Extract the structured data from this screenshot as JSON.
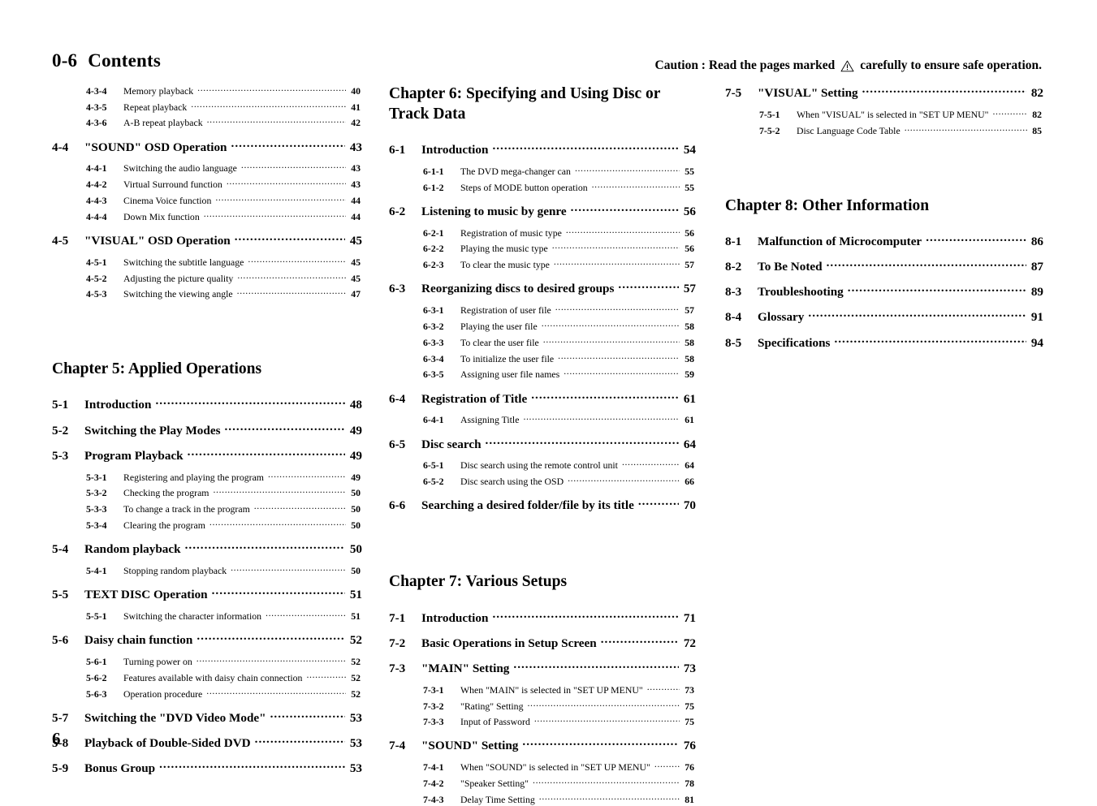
{
  "header": {
    "section_number": "0-6",
    "title": "Contents",
    "caution_prefix": "Caution : Read the pages marked",
    "caution_icon": "warning-triangle-icon",
    "caution_suffix": "carefully to ensure safe operation."
  },
  "folio": "6",
  "columns": [
    {
      "id": "column-1",
      "blocks": [
        {
          "type": "group",
          "entries": [
            {
              "level": 2,
              "num": "4-3-4",
              "title": "Memory playback",
              "page": "40"
            },
            {
              "level": 2,
              "num": "4-3-5",
              "title": "Repeat playback",
              "page": "41"
            },
            {
              "level": 2,
              "num": "4-3-6",
              "title": "A-B repeat playback",
              "page": "42"
            }
          ]
        },
        {
          "type": "group",
          "entries": [
            {
              "level": 1,
              "num": "4-4",
              "title": "\"SOUND\" OSD Operation",
              "page": "43"
            },
            {
              "level": 2,
              "num": "4-4-1",
              "title": "Switching the audio language",
              "page": "43"
            },
            {
              "level": 2,
              "num": "4-4-2",
              "title": "Virtual Surround function",
              "page": "43"
            },
            {
              "level": 2,
              "num": "4-4-3",
              "title": "Cinema Voice function",
              "page": "44"
            },
            {
              "level": 2,
              "num": "4-4-4",
              "title": "Down Mix function",
              "page": "44"
            }
          ]
        },
        {
          "type": "group",
          "entries": [
            {
              "level": 1,
              "num": "4-5",
              "title": "\"VISUAL\" OSD Operation",
              "page": "45"
            },
            {
              "level": 2,
              "num": "4-5-1",
              "title": "Switching the subtitle language",
              "page": "45"
            },
            {
              "level": 2,
              "num": "4-5-2",
              "title": "Adjusting the picture quality",
              "page": "45"
            },
            {
              "level": 2,
              "num": "4-5-3",
              "title": "Switching the viewing angle",
              "page": "47"
            }
          ]
        },
        {
          "type": "gap-xl"
        },
        {
          "type": "chapter",
          "title": "Chapter 5: Applied Operations"
        },
        {
          "type": "group",
          "entries": [
            {
              "level": 1,
              "num": "5-1",
              "title": "Introduction",
              "page": "48"
            }
          ]
        },
        {
          "type": "group",
          "entries": [
            {
              "level": 1,
              "num": "5-2",
              "title": "Switching the Play Modes",
              "page": "49"
            }
          ]
        },
        {
          "type": "group",
          "entries": [
            {
              "level": 1,
              "num": "5-3",
              "title": "Program Playback",
              "page": "49"
            },
            {
              "level": 2,
              "num": "5-3-1",
              "title": "Registering and playing the program",
              "page": "49"
            },
            {
              "level": 2,
              "num": "5-3-2",
              "title": "Checking the program",
              "page": "50"
            },
            {
              "level": 2,
              "num": "5-3-3",
              "title": "To change a track in the program",
              "page": "50"
            },
            {
              "level": 2,
              "num": "5-3-4",
              "title": "Clearing the program",
              "page": "50"
            }
          ]
        },
        {
          "type": "group",
          "entries": [
            {
              "level": 1,
              "num": "5-4",
              "title": "Random playback",
              "page": "50"
            },
            {
              "level": 2,
              "num": "5-4-1",
              "title": "Stopping random playback",
              "page": "50"
            }
          ]
        },
        {
          "type": "group",
          "entries": [
            {
              "level": 1,
              "num": "5-5",
              "title": "TEXT DISC Operation",
              "page": "51"
            },
            {
              "level": 2,
              "num": "5-5-1",
              "title": "Switching the character information",
              "page": "51"
            }
          ]
        },
        {
          "type": "group",
          "entries": [
            {
              "level": 1,
              "num": "5-6",
              "title": "Daisy chain function",
              "page": "52"
            },
            {
              "level": 2,
              "num": "5-6-1",
              "title": "Turning power on",
              "page": "52"
            },
            {
              "level": 2,
              "num": "5-6-2",
              "title": "Features available with daisy chain connection",
              "page": "52"
            },
            {
              "level": 2,
              "num": "5-6-3",
              "title": "Operation procedure",
              "page": "52"
            }
          ]
        },
        {
          "type": "group",
          "entries": [
            {
              "level": 1,
              "num": "5-7",
              "title": "Switching the \"DVD Video Mode\"",
              "page": "53"
            }
          ]
        },
        {
          "type": "group",
          "entries": [
            {
              "level": 1,
              "num": "5-8",
              "title": "Playback of Double-Sided DVD",
              "page": "53"
            }
          ]
        },
        {
          "type": "group",
          "entries": [
            {
              "level": 1,
              "num": "5-9",
              "title": "Bonus Group",
              "page": "53"
            }
          ]
        }
      ]
    },
    {
      "id": "column-2",
      "blocks": [
        {
          "type": "chapter",
          "title": "Chapter 6: Specifying and Using Disc or Track Data"
        },
        {
          "type": "group",
          "entries": [
            {
              "level": 1,
              "num": "6-1",
              "title": "Introduction",
              "page": "54"
            },
            {
              "level": 2,
              "num": "6-1-1",
              "title": "The DVD mega-changer can",
              "page": "55"
            },
            {
              "level": 2,
              "num": "6-1-2",
              "title": "Steps of MODE button operation",
              "page": "55"
            }
          ]
        },
        {
          "type": "group",
          "entries": [
            {
              "level": 1,
              "num": "6-2",
              "title": "Listening to music by genre",
              "page": "56"
            },
            {
              "level": 2,
              "num": "6-2-1",
              "title": "Registration of music type",
              "page": "56"
            },
            {
              "level": 2,
              "num": "6-2-2",
              "title": "Playing the music type",
              "page": "56"
            },
            {
              "level": 2,
              "num": "6-2-3",
              "title": "To clear the music type",
              "page": "57"
            }
          ]
        },
        {
          "type": "group",
          "entries": [
            {
              "level": 1,
              "num": "6-3",
              "title": "Reorganizing discs to desired groups",
              "page": "57"
            },
            {
              "level": 2,
              "num": "6-3-1",
              "title": "Registration of user file",
              "page": "57"
            },
            {
              "level": 2,
              "num": "6-3-2",
              "title": "Playing the user file",
              "page": "58"
            },
            {
              "level": 2,
              "num": "6-3-3",
              "title": "To clear the user file",
              "page": "58"
            },
            {
              "level": 2,
              "num": "6-3-4",
              "title": "To initialize the user file",
              "page": "58"
            },
            {
              "level": 2,
              "num": "6-3-5",
              "title": "Assigning user file names",
              "page": "59"
            }
          ]
        },
        {
          "type": "group",
          "entries": [
            {
              "level": 1,
              "num": "6-4",
              "title": "Registration of Title",
              "page": "61"
            },
            {
              "level": 2,
              "num": "6-4-1",
              "title": "Assigning Title",
              "page": "61"
            }
          ]
        },
        {
          "type": "group",
          "entries": [
            {
              "level": 1,
              "num": "6-5",
              "title": "Disc search",
              "page": "64"
            },
            {
              "level": 2,
              "num": "6-5-1",
              "title": "Disc search using the remote control unit",
              "page": "64"
            },
            {
              "level": 2,
              "num": "6-5-2",
              "title": "Disc search using the OSD",
              "page": "66"
            }
          ]
        },
        {
          "type": "group",
          "entries": [
            {
              "level": 1,
              "num": "6-6",
              "title": "Searching a desired folder/file by its title",
              "page": "70"
            }
          ]
        },
        {
          "type": "gap-xl"
        },
        {
          "type": "chapter",
          "title": "Chapter 7: Various Setups"
        },
        {
          "type": "group",
          "entries": [
            {
              "level": 1,
              "num": "7-1",
              "title": "Introduction",
              "page": "71"
            }
          ]
        },
        {
          "type": "group",
          "entries": [
            {
              "level": 1,
              "num": "7-2",
              "title": "Basic Operations in Setup Screen",
              "page": "72"
            }
          ]
        },
        {
          "type": "group",
          "entries": [
            {
              "level": 1,
              "num": "7-3",
              "title": "\"MAIN\" Setting",
              "page": "73"
            },
            {
              "level": 2,
              "num": "7-3-1",
              "title": "When \"MAIN\" is selected in \"SET UP MENU\"",
              "page": "73"
            },
            {
              "level": 2,
              "num": "7-3-2",
              "title": "\"Rating\" Setting",
              "page": "75"
            },
            {
              "level": 2,
              "num": "7-3-3",
              "title": "Input of Password",
              "page": "75"
            }
          ]
        },
        {
          "type": "group",
          "entries": [
            {
              "level": 1,
              "num": "7-4",
              "title": "\"SOUND\" Setting",
              "page": "76"
            },
            {
              "level": 2,
              "num": "7-4-1",
              "title": "When \"SOUND\" is selected in \"SET UP MENU\"",
              "page": "76"
            },
            {
              "level": 2,
              "num": "7-4-2",
              "title": "\"Speaker Setting\"",
              "page": "78"
            },
            {
              "level": 2,
              "num": "7-4-3",
              "title": "Delay Time Setting",
              "page": "81"
            }
          ]
        }
      ]
    },
    {
      "id": "column-3",
      "blocks": [
        {
          "type": "group",
          "entries": [
            {
              "level": 1,
              "num": "7-5",
              "title": "\"VISUAL\" Setting",
              "page": "82"
            },
            {
              "level": 2,
              "num": "7-5-1",
              "title": "When \"VISUAL\" is selected in \"SET UP MENU\"",
              "page": "82"
            },
            {
              "level": 2,
              "num": "7-5-2",
              "title": "Disc Language Code Table",
              "page": "85"
            }
          ]
        },
        {
          "type": "gap-xl"
        },
        {
          "type": "chapter",
          "title": "Chapter 8: Other Information"
        },
        {
          "type": "group",
          "entries": [
            {
              "level": 1,
              "num": "8-1",
              "title": "Malfunction of Microcomputer",
              "page": "86"
            }
          ]
        },
        {
          "type": "group",
          "entries": [
            {
              "level": 1,
              "num": "8-2",
              "title": "To Be Noted",
              "page": "87"
            }
          ]
        },
        {
          "type": "group",
          "entries": [
            {
              "level": 1,
              "num": "8-3",
              "title": "Troubleshooting",
              "page": "89"
            }
          ]
        },
        {
          "type": "group",
          "entries": [
            {
              "level": 1,
              "num": "8-4",
              "title": "Glossary",
              "page": "91"
            }
          ]
        },
        {
          "type": "group",
          "entries": [
            {
              "level": 1,
              "num": "8-5",
              "title": "Specifications",
              "page": "94"
            }
          ]
        }
      ]
    }
  ]
}
